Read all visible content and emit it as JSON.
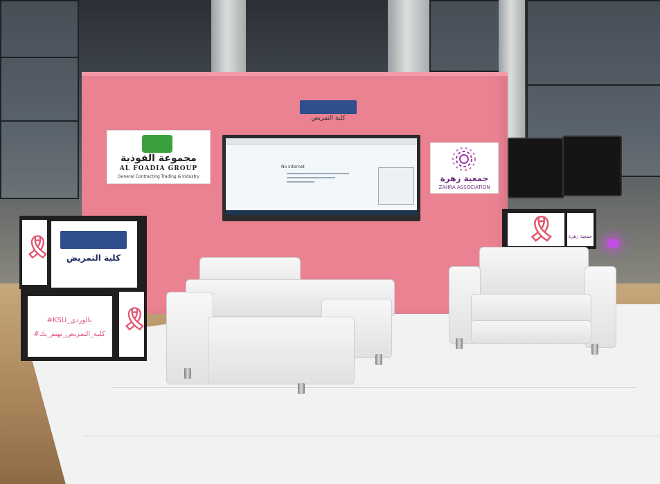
{
  "scene": {
    "wall_color": "#ea8292",
    "floor_color": "#f1f2f2"
  },
  "wall_badge": {
    "caption": "كلية التمريض"
  },
  "foadia_sign": {
    "arabic_name": "مجموعة الفوذية",
    "english_name": "AL FOADIA GROUP",
    "tagline": "General Contracting Trading & Industry"
  },
  "zahra_sign": {
    "arabic_name": "جمعية زهرة",
    "english_name": "ZAHRA ASSOCIATION"
  },
  "monitor": {
    "message": "No internet"
  },
  "left_cube": {
    "logo_caption": "كلية التمريض",
    "hashtag_1": "#KSU_بالوردي",
    "hashtag_2": "#كلية_التمريض_تهتم_بك"
  },
  "right_cube": {
    "label": "جمعية زهرة"
  }
}
